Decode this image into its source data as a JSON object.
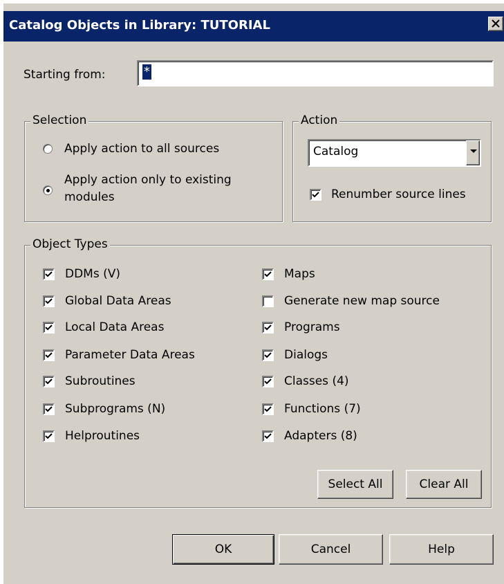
{
  "window": {
    "title": "Catalog Objects in Library: TUTORIAL",
    "close_glyph": "close-icon"
  },
  "starting_from": {
    "label": "Starting from:",
    "value": "*"
  },
  "selection": {
    "title": "Selection",
    "options": [
      {
        "label": "Apply action to all sources",
        "checked": false
      },
      {
        "label_line1": "Apply action only to existing",
        "label_line2": "modules",
        "checked": true
      }
    ]
  },
  "action": {
    "title": "Action",
    "selected": "Catalog",
    "renumber_label": "Renumber source lines",
    "renumber_checked": true
  },
  "object_types": {
    "title": "Object Types",
    "left": [
      {
        "label": "DDMs (V)",
        "checked": true
      },
      {
        "label": "Global Data Areas",
        "checked": true
      },
      {
        "label": "Local Data Areas",
        "checked": true
      },
      {
        "label": "Parameter Data Areas",
        "checked": true
      },
      {
        "label": "Subroutines",
        "checked": true
      },
      {
        "label": "Subprograms (N)",
        "checked": true
      },
      {
        "label": "Helproutines",
        "checked": true
      }
    ],
    "right": [
      {
        "label": "Maps",
        "checked": true
      },
      {
        "label": "Generate new map source",
        "checked": false
      },
      {
        "label": "Programs",
        "checked": true
      },
      {
        "label": "Dialogs",
        "checked": true
      },
      {
        "label": "Classes (4)",
        "checked": true
      },
      {
        "label": "Functions (7)",
        "checked": true
      },
      {
        "label": "Adapters (8)",
        "checked": true
      }
    ],
    "select_all_label": "Select All",
    "clear_all_label": "Clear All"
  },
  "buttons": {
    "ok": "OK",
    "cancel": "Cancel",
    "help": "Help"
  },
  "colors": {
    "titlebar": "#0a246a",
    "face": "#d4d0c8"
  }
}
